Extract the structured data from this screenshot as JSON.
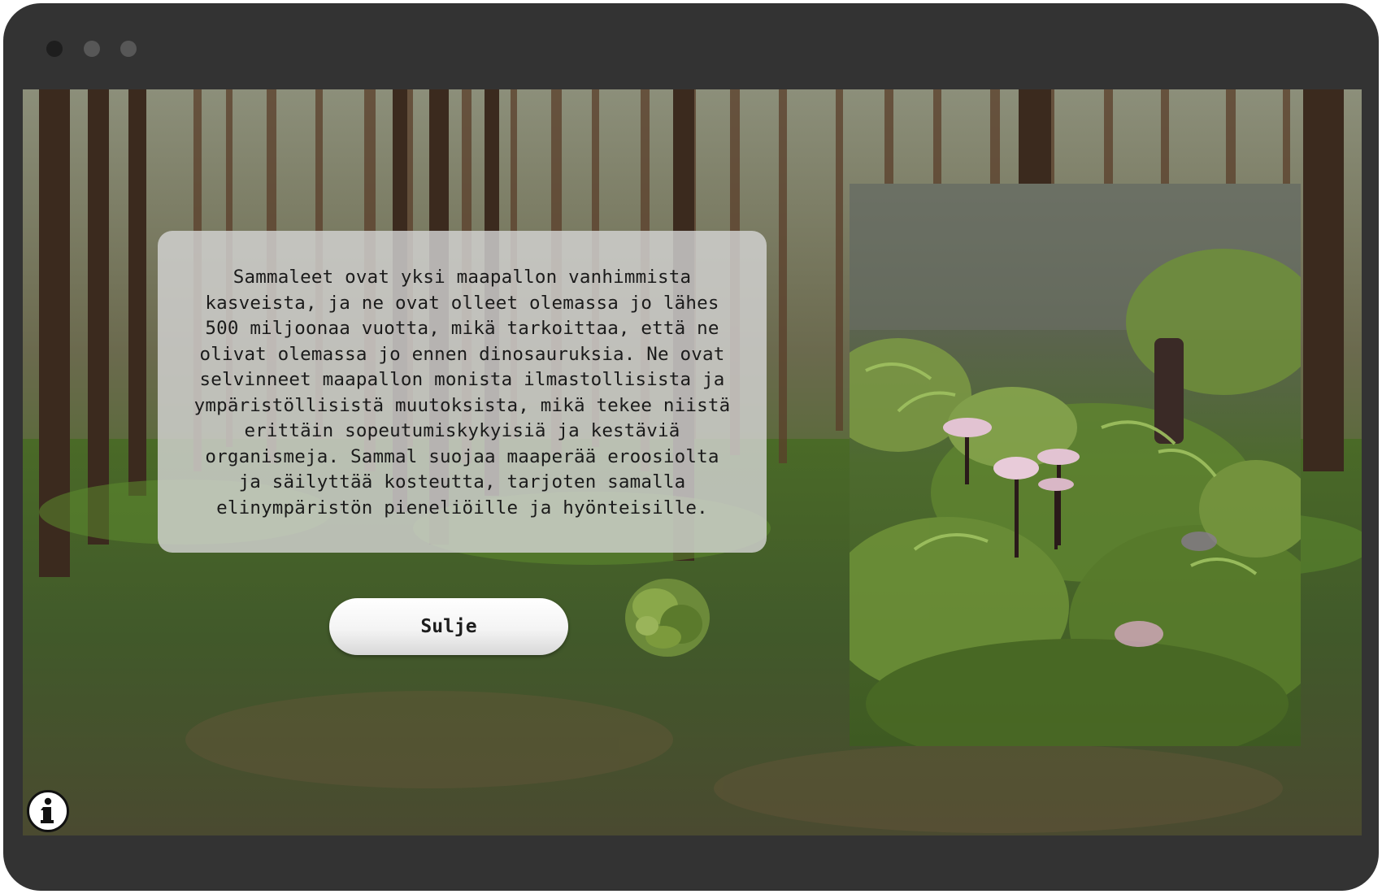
{
  "window": {
    "controls": [
      "close-dot",
      "minimize-dot",
      "maximize-dot"
    ]
  },
  "info_panel": {
    "text": "Sammaleet ovat yksi maapallon vanhimmista kasveista, ja ne ovat olleet olemassa jo lähes 500 miljoonaa vuotta, mikä tarkoittaa, että ne olivat olemassa jo ennen dinosauruksia. Ne ovat selvinneet maapallon monista ilmastollisista ja ympäristöllisistä muutoksista, mikä tekee niistä erittäin sopeutumiskykyisiä ja kestäviä organismeja. Sammal suojaa maaperää eroosiolta ja säilyttää kosteutta, tarjoten samalla elinympäristön pieneliöille ja hyönteisille."
  },
  "close_button": {
    "label": "Sulje"
  },
  "photo": {
    "subject": "moss-with-small-pink-mushrooms"
  },
  "info_icon": {
    "icon": "info-icon"
  },
  "colors": {
    "window_frame": "#333333",
    "panel_background": "#d6d6d6",
    "text": "#1b1b1b",
    "mushroom_cap": "#e2c3d2"
  }
}
